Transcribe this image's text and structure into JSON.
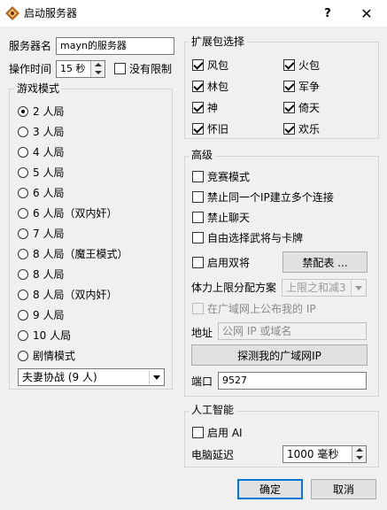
{
  "window": {
    "title": "启动服务器",
    "help": "?",
    "close": "✕"
  },
  "server": {
    "name_label": "服务器名",
    "name_value": "mayn的服务器",
    "time_label": "操作时间",
    "time_value": "15 秒",
    "no_limit_label": "没有限制",
    "no_limit_checked": false
  },
  "game_mode": {
    "title": "游戏模式",
    "options": [
      {
        "label": "2 人局",
        "selected": true
      },
      {
        "label": "3 人局",
        "selected": false
      },
      {
        "label": "4 人局",
        "selected": false
      },
      {
        "label": "5 人局",
        "selected": false
      },
      {
        "label": "6 人局",
        "selected": false
      },
      {
        "label": "6 人局（双内奸）",
        "selected": false
      },
      {
        "label": "7 人局",
        "selected": false
      },
      {
        "label": "8 人局（魔王模式）",
        "selected": false
      },
      {
        "label": "8 人局",
        "selected": false
      },
      {
        "label": "8 人局（双内奸）",
        "selected": false
      },
      {
        "label": "9 人局",
        "selected": false
      },
      {
        "label": "10 人局",
        "selected": false
      },
      {
        "label": "剧情模式",
        "selected": false
      }
    ],
    "scenario_value": "夫妻协战 (9 人)"
  },
  "expansions": {
    "title": "扩展包选择",
    "items": [
      {
        "label": "风包",
        "checked": true
      },
      {
        "label": "火包",
        "checked": true
      },
      {
        "label": "林包",
        "checked": true
      },
      {
        "label": "军争",
        "checked": true
      },
      {
        "label": "神",
        "checked": true
      },
      {
        "label": "倚天",
        "checked": true
      },
      {
        "label": "怀旧",
        "checked": true
      },
      {
        "label": "欢乐",
        "checked": true
      }
    ]
  },
  "advanced": {
    "title": "高级",
    "contest_mode": "竞赛模式",
    "forbid_same_ip": "禁止同一个IP建立多个连接",
    "forbid_chat": "禁止聊天",
    "free_choose": "自由选择武将与卡牌",
    "dual_general": "启用双将",
    "ban_table_button": "禁配表 ...",
    "hp_scheme_label": "体力上限分配方案",
    "hp_scheme_value": "上限之和减3",
    "publish_ip": "在广域网上公布我的 IP",
    "address_label": "地址",
    "address_placeholder": "公网 IP 或域名",
    "detect_ip_button": "探测我的广域网IP",
    "port_label": "端口",
    "port_value": "9527"
  },
  "ai": {
    "title": "人工智能",
    "enable_ai": "启用 AI",
    "delay_label": "电脑延迟",
    "delay_value": "1000 毫秒"
  },
  "footer": {
    "ok": "确定",
    "cancel": "取消"
  }
}
